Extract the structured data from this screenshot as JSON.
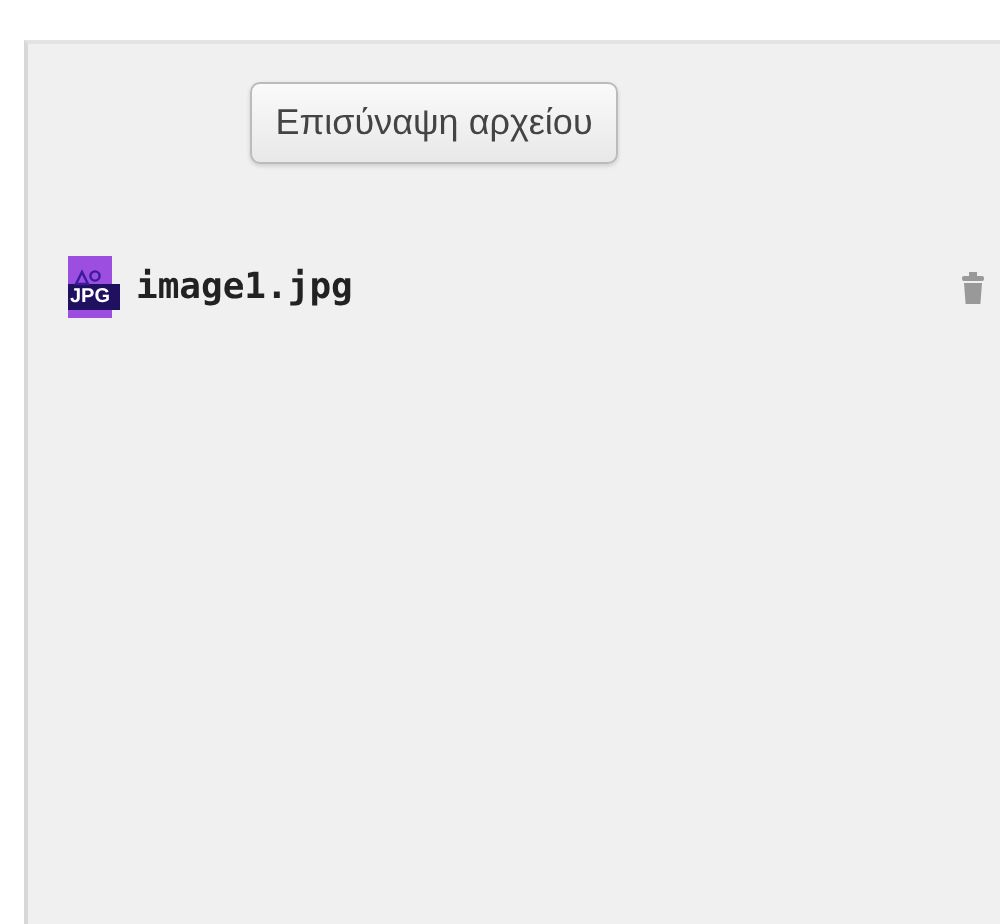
{
  "attach_button": "Επισύναψη αρχείου",
  "files": [
    {
      "name": "image1.jpg",
      "type_label": "JPG"
    }
  ]
}
